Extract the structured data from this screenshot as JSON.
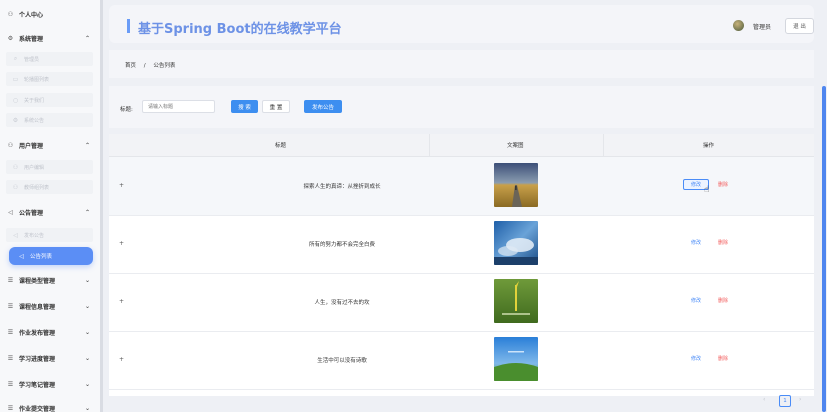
{
  "sidebar": {
    "personal_center": "个人中心",
    "groups": [
      {
        "label": "系统管理",
        "items": [
          "管理员",
          "轮播图列表",
          "关于我们",
          "系统公告"
        ]
      },
      {
        "label": "用户管理",
        "items": [
          "用户编辑",
          "教师组列表"
        ]
      },
      {
        "label": "公告管理",
        "items": [
          "发布公告",
          "公告列表"
        ]
      }
    ],
    "active_item": "公告列表",
    "collapsed_groups": [
      "课程类型管理",
      "课程信息管理",
      "作业发布管理",
      "学习进度管理",
      "学习笔记管理",
      "作业提交管理"
    ]
  },
  "header": {
    "title": "基于Spring Boot的在线教学平台",
    "user_name": "管理员",
    "logout_label": "退 出"
  },
  "breadcrumb": {
    "home": "首页",
    "separator": "/",
    "current": "公告列表"
  },
  "search": {
    "label": "标题:",
    "placeholder": "请输入标题",
    "search_button": "搜 索",
    "reset_button": "重 置",
    "publish_button": "发布公告"
  },
  "table": {
    "columns": [
      "标题",
      "文案图",
      "操作"
    ],
    "rows": [
      {
        "title": "探索人生的真谛：从挫折到成长",
        "image": "golden-field-road"
      },
      {
        "title": "所有的努力都不会完全白费",
        "image": "blue-sky-clouds"
      },
      {
        "title": "人生，没有过不去的坎",
        "image": "green-grass-sprout"
      },
      {
        "title": "生活中可以没有诗歌",
        "image": "blue-sky-hill"
      }
    ],
    "edit_label": "修改",
    "delete_label": "删除",
    "expand_symbol": "+"
  },
  "pagination": {
    "prev": "‹",
    "current_page": "1",
    "next": "›"
  },
  "colors": {
    "accent": "#4a8cf7",
    "title": "#6d92e6",
    "danger": "#f25c5c",
    "active_nav": "#5b8ef5"
  }
}
